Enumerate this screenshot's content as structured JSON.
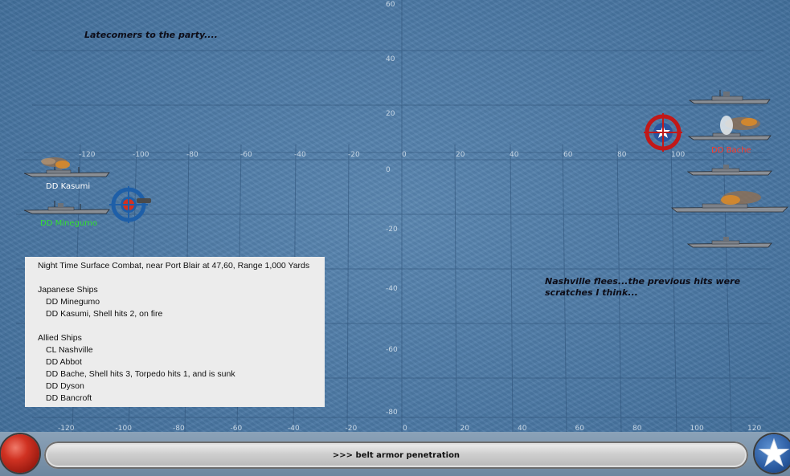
{
  "notes": {
    "latecomers": "Latecomers to the party....",
    "nashville_line1": "Nashville flees...the previous hits were",
    "nashville_line2": "scratches I think..."
  },
  "axis": {
    "top_labels": [
      "-120",
      "-100",
      "-80",
      "-60",
      "-40",
      "-20",
      "0",
      "20",
      "40",
      "60",
      "80",
      "100"
    ],
    "bottom_labels": [
      "-120",
      "-100",
      "-80",
      "-60",
      "-40",
      "-20",
      "0",
      "20",
      "40",
      "60",
      "80",
      "100",
      "120"
    ],
    "vertical_labels": [
      "60",
      "40",
      "20",
      "0",
      "-20",
      "-40",
      "-60",
      "-80"
    ]
  },
  "ship_labels": {
    "kasumi": "DD Kasumi",
    "minegumo": "DD Minegumo",
    "bache": "DD Bache"
  },
  "colors": {
    "japanese_label": "#ffffff",
    "minegumo_label": "#33dd33",
    "bache_label": "#ff3a2a",
    "japanese_target": "#1e5fa8",
    "allied_target": "#c21818"
  },
  "report": {
    "header": "Night Time Surface Combat, near Port Blair at 47,60, Range 1,000 Yards",
    "japanese_title": "Japanese Ships",
    "japanese_ships": [
      "DD Minegumo",
      "DD Kasumi, Shell hits 2,  on fire"
    ],
    "allied_title": "Allied Ships",
    "allied_ships": [
      "CL Nashville",
      "DD Abbot",
      "DD Bache, Shell hits 3, Torpedo hits 1, and is sunk",
      "DD Dyson",
      "DD Bancroft"
    ]
  },
  "status_bar": {
    "message": ">>> belt armor penetration"
  },
  "icons": {
    "red_button": "red-orb-icon",
    "star_button": "us-star-icon"
  }
}
